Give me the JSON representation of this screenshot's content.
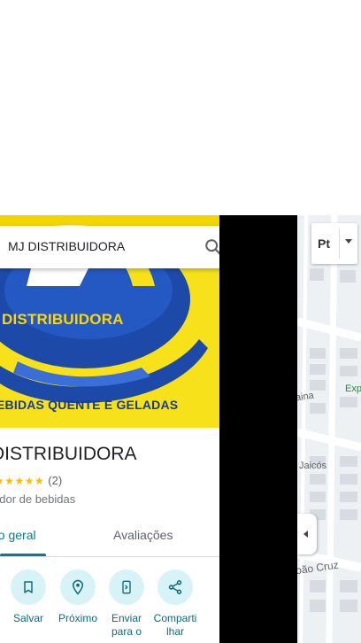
{
  "search": {
    "query": "MJ DISTRIBUIDORA"
  },
  "hero": {
    "brand": "DISTRIBUIDORA",
    "tagline": "EBIDAS QUENTE E GELADAS"
  },
  "place": {
    "title": "DISTRIBUIDORA",
    "stars": "★★★★★",
    "review_count": "(2)",
    "category": "edor de bebidas"
  },
  "tabs": [
    {
      "label": "ão geral",
      "active": true
    },
    {
      "label": "Avaliações",
      "active": false
    }
  ],
  "actions": [
    {
      "label": "Salvar",
      "icon": "bookmark-icon"
    },
    {
      "label": "Próximo",
      "icon": "nearby-icon"
    },
    {
      "label": "Enviar para o",
      "icon": "send-to-phone-icon"
    },
    {
      "label": "Comparti lhar",
      "icon": "share-icon"
    }
  ],
  "map": {
    "labels": {
      "ina": "aina",
      "jaicos": "Jaicós",
      "cruz": "oão Cruz",
      "exp": "Exp"
    },
    "layer_button": "Pt"
  },
  "colors": {
    "accent": "#0b7b8e",
    "hero_bg": "#f6e11a",
    "hero_blue": "#183b8f",
    "action_bg": "#d7f3f8",
    "star": "#fbbc04"
  }
}
